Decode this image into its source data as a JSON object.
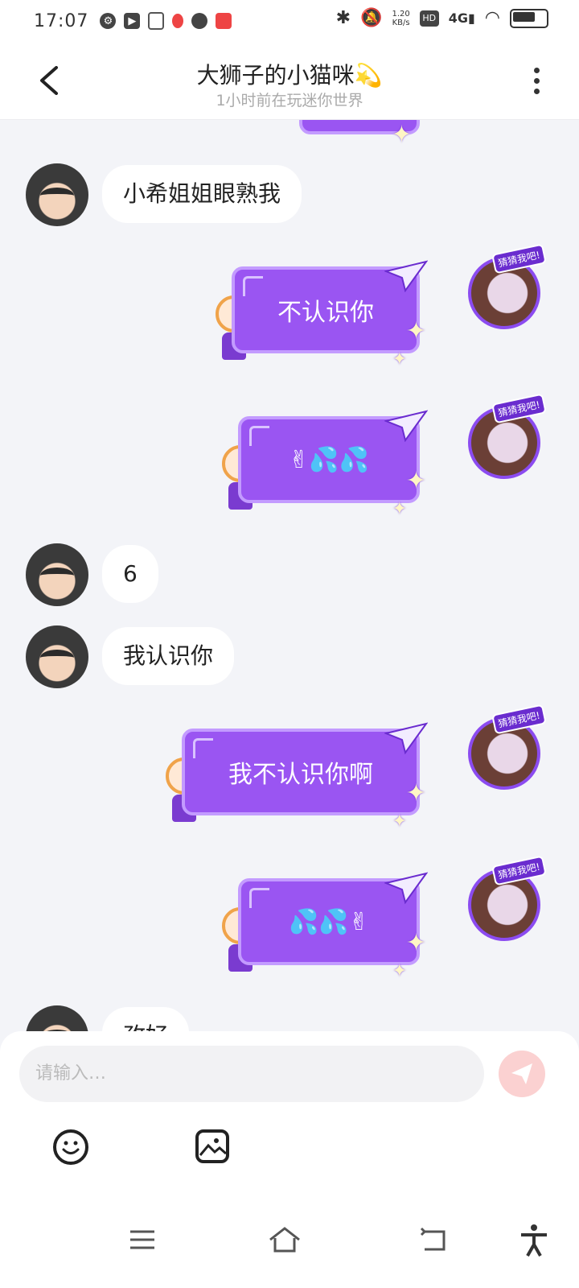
{
  "status_bar": {
    "time": "17:07",
    "net_speed_value": "1.20",
    "net_speed_unit": "KB/s",
    "network_type": "4G",
    "hd_label": "HD",
    "battery_level": 0.75,
    "left_icons": [
      "gear-icon",
      "play-icon",
      "document-icon",
      "map-pin-icon",
      "chat-icon",
      "app-badge-icon"
    ],
    "right_icons": [
      "bluetooth-icon",
      "mute-icon",
      "hd-icon",
      "signal-icon",
      "wifi-icon",
      "battery-icon"
    ]
  },
  "header": {
    "title": "大狮子的小猫咪💫",
    "subtitle": "1小时前在玩迷你世界"
  },
  "messages": [
    {
      "side": "left",
      "text": "小希姐姐眼熟我"
    },
    {
      "side": "right",
      "text": "不认识你"
    },
    {
      "side": "right",
      "text": "✌💦💦"
    },
    {
      "side": "left",
      "text": "6"
    },
    {
      "side": "left",
      "text": "我认识你"
    },
    {
      "side": "right",
      "text": "我不认识你啊"
    },
    {
      "side": "right",
      "text": "💦💦✌"
    },
    {
      "side": "left",
      "text": "孜好"
    }
  ],
  "right_avatar_tag": "猜猜我吧!",
  "input": {
    "placeholder": "请输入…"
  },
  "colors": {
    "bubble_right": "#9a55f2",
    "bubble_right_border": "#c39bff",
    "send_button": "#fbd1d1",
    "background": "#f3f4f8"
  },
  "toolbar_icons": [
    "emoji-icon",
    "image-icon"
  ],
  "nav_icons": [
    "menu-icon",
    "home-icon",
    "back-icon",
    "accessibility-icon"
  ]
}
